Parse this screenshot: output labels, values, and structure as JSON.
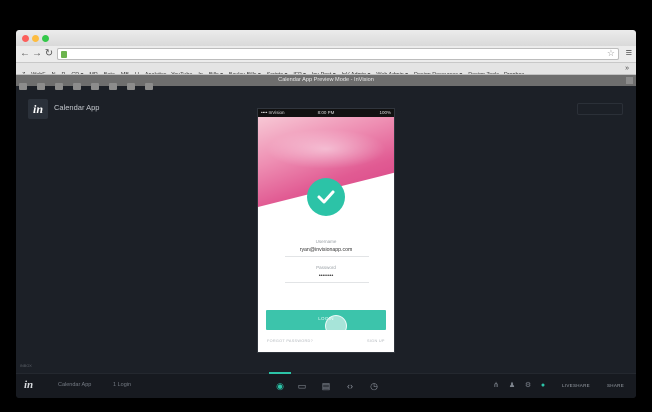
{
  "browser": {
    "tab_title": "Calendar App Preview Mode - InVision",
    "bookmarks": [
      "Z",
      "WebF",
      "N",
      "R",
      "CD ▾",
      "MR",
      "Beta",
      "MB",
      "U",
      "Analytics - YouTube",
      "In",
      "Bills ▾",
      "Bayley Bills ▾",
      "Scripts ▾",
      "IFP ▾",
      "Inv Post ▾",
      "InV Admin ▾",
      "Web Admin ▾",
      "Design Resources ▾",
      "Design Tools - Dropbox"
    ],
    "bookmarks_more": "»"
  },
  "app": {
    "logo": "in",
    "project_name": "Calendar App"
  },
  "phone": {
    "status": {
      "carrier": "•••• InVision",
      "time": "8:00 PM",
      "battery": "100%"
    },
    "username_label": "Username",
    "username_value": "ryan@invisionapp.com",
    "password_label": "Password",
    "password_value": "••••••••",
    "login_label": "LOGIN",
    "forgot_label": "FORGOT PASSWORD?",
    "signup_label": "SIGN UP"
  },
  "bottom_bar": {
    "logo": "in",
    "project": "Calendar App",
    "screen": "1 Login",
    "live_share": "LIVESHARE",
    "share": "SHARE",
    "note": "INBOX"
  },
  "colors": {
    "accent": "#2cc3a7",
    "hero_pink": "#e15b93",
    "app_bg": "#1c2027"
  }
}
